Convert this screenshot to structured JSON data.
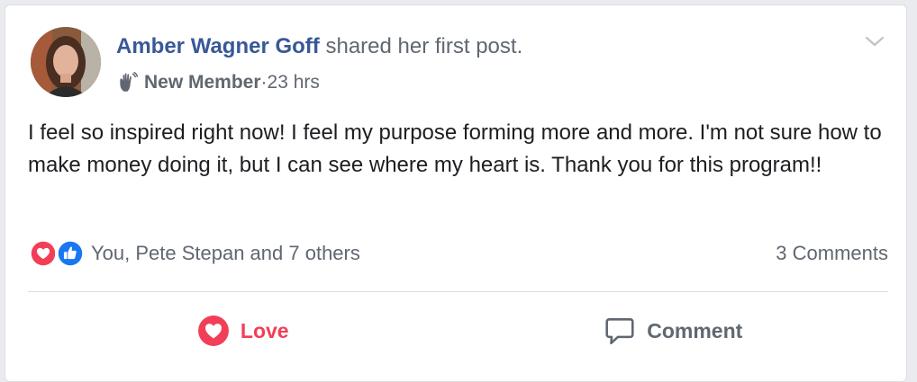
{
  "post": {
    "author": "Amber Wagner Goff",
    "action_text": " shared her first post.",
    "badge": "New Member",
    "separator": " · ",
    "time": "23 hrs",
    "body": "I feel so inspired right now! I feel my purpose forming more and more. I'm not sure how to make money doing it, but I can see where my heart is. Thank you for this program!!",
    "reactions": {
      "icons": [
        "love-icon",
        "like-icon"
      ],
      "names": "You, Pete Stepan and 7 others"
    },
    "comments_count": "3 Comments"
  },
  "actions": {
    "love_label": "Love",
    "comment_label": "Comment"
  },
  "colors": {
    "author": "#385898",
    "love": "#f33e58",
    "like": "#1877f2",
    "muted": "#606770",
    "text": "#1c1e21"
  }
}
